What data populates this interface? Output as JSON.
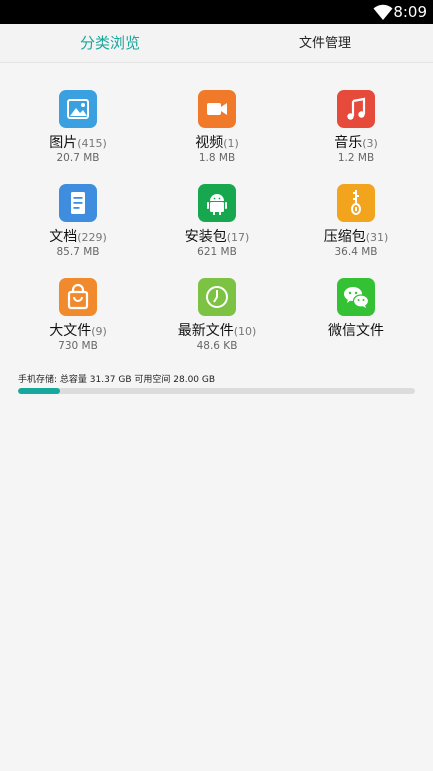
{
  "status_bar": {
    "time": "8:09",
    "wifi_icon": "wifi-icon"
  },
  "tabs": [
    {
      "label": "分类浏览",
      "active": true
    },
    {
      "label": "文件管理",
      "active": false
    }
  ],
  "categories": [
    {
      "name": "图片",
      "count": "(415)",
      "size": "20.7 MB",
      "icon": "image-icon",
      "color": "#3aa0e0"
    },
    {
      "name": "视频",
      "count": "(1)",
      "size": "1.8 MB",
      "icon": "video-icon",
      "color": "#f07a2a"
    },
    {
      "name": "音乐",
      "count": "(3)",
      "size": "1.2 MB",
      "icon": "music-icon",
      "color": "#e64a3b"
    },
    {
      "name": "文档",
      "count": "(229)",
      "size": "85.7 MB",
      "icon": "document-icon",
      "color": "#3f8ddf"
    },
    {
      "name": "安装包",
      "count": "(17)",
      "size": "621 MB",
      "icon": "android-icon",
      "color": "#17a84f"
    },
    {
      "name": "压缩包",
      "count": "(31)",
      "size": "36.4 MB",
      "icon": "zip-icon",
      "color": "#f2a51c"
    },
    {
      "name": "大文件",
      "count": "(9)",
      "size": "730 MB",
      "icon": "shopping-bag-icon",
      "color": "#f08a2c"
    },
    {
      "name": "最新文件",
      "count": "(10)",
      "size": "48.6 KB",
      "icon": "clock-icon",
      "color": "#7cc243"
    },
    {
      "name": "微信文件",
      "count": "",
      "size": "",
      "icon": "wechat-icon",
      "color": "#34c234"
    }
  ],
  "storage": {
    "label": "手机存储: 总容量 31.37 GB  可用空间 28.00 GB",
    "used_fraction": 0.107,
    "bar_color": "#16a89c"
  }
}
